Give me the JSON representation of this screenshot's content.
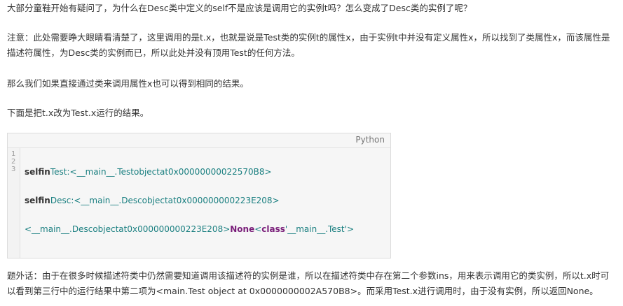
{
  "paragraphs": {
    "p1": "大部分童鞋开始有疑问了，为什么在Desc类中定义的self不是应该是调用它的实例t吗？怎么变成了Desc类的实例了呢？",
    "p2": "注意：此处需要睁大眼睛看清楚了，这里调用的是t.x，也就是说是Test类的实例t的属性x，由于实例t中并没有定义属性x，所以找到了类属性x，而该属性是描述符属性，为Desc类的实例而已，所以此处并没有顶用Test的任何方法。",
    "p3": "那么我们如果直接通过类来调用属性x也可以得到相同的结果。",
    "p4": "下面是把t.x改为Test.x运行的结果。",
    "p5": "题外话：由于在很多时候描述符类中仍然需要知道调用该描述符的实例是谁，所以在描述符类中存在第二个参数ins，用来表示调用它的类实例，所以t.x时可以看到第三行中的运行结果中第二项为<main.Test object at 0x0000000002A570B8>。而采用Test.x进行调用时，由于没有实例，所以返回None。"
  },
  "code_block": {
    "language": "Python",
    "line_numbers": [
      "1",
      "2",
      "3"
    ],
    "line1": {
      "keyword": "selfin",
      "text": "Test:<__main__.Testobjectat0x00000000022570B8>"
    },
    "line2": {
      "keyword": "selfin",
      "text": "Desc:<__main__.Descobjectat0x000000000223E208>"
    },
    "line3": {
      "text_a": "<__main__.Descobjectat0x000000000223E208>",
      "none_kw": "None",
      "lt": "<",
      "class_kw": "class",
      "str_part": "'__main__.Test'",
      "gt": ">"
    }
  },
  "colors": {
    "text": "#333333",
    "code_teal": "#1a7f80",
    "code_purple": "#7a1f7a",
    "code_bg": "#f6f6f6"
  }
}
